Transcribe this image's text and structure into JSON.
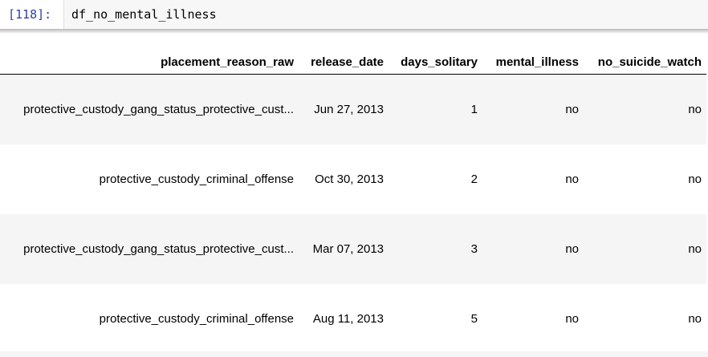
{
  "cell": {
    "prompt": "[118]:",
    "code": "df_no_mental_illness"
  },
  "table": {
    "columns": [
      "placement_reason_raw",
      "release_date",
      "days_solitary",
      "mental_illness",
      "no_suicide_watch"
    ],
    "rows": [
      [
        "protective_custody_gang_status_protective_cust...",
        "Jun 27, 2013",
        "1",
        "no",
        "no"
      ],
      [
        "protective_custody_criminal_offense",
        "Oct 30, 2013",
        "2",
        "no",
        "no"
      ],
      [
        "protective_custody_gang_status_protective_cust...",
        "Mar 07, 2013",
        "3",
        "no",
        "no"
      ],
      [
        "protective_custody_criminal_offense",
        "Aug 11, 2013",
        "5",
        "no",
        "no"
      ]
    ]
  },
  "colors": {
    "prompt": "#303f9f",
    "code_background": "#f7f7f7",
    "row_stripe": "#f5f5f5"
  }
}
